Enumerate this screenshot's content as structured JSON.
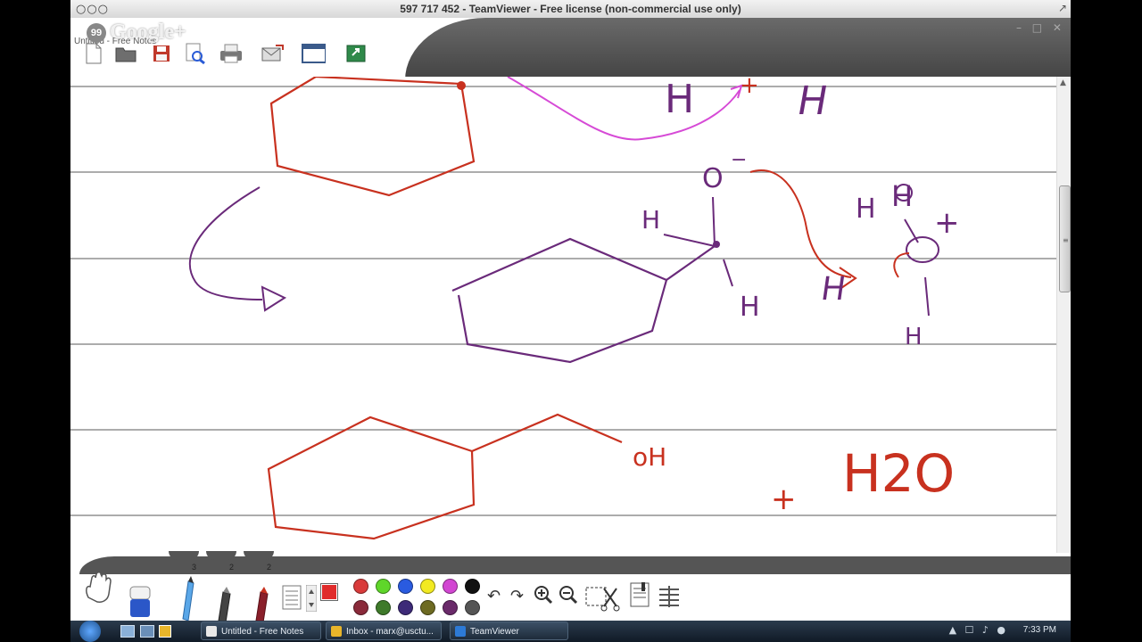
{
  "teamviewer": {
    "title": "597 717 452 - TeamViewer - Free license (non-commercial use only)",
    "window_controls": "○○○",
    "resize_icon": "resize-icon"
  },
  "app": {
    "tab_title": "Untitled - Free Notes",
    "overlay_badge": "99",
    "overlay_brand": "Google+",
    "toolbar": [
      {
        "name": "new-note-button",
        "icon": "new-document-icon"
      },
      {
        "name": "open-button",
        "icon": "folder-icon"
      },
      {
        "name": "save-button",
        "icon": "floppy-disk-icon"
      },
      {
        "name": "preview-button",
        "icon": "magnifier-page-icon"
      },
      {
        "name": "print-button",
        "icon": "printer-icon"
      },
      {
        "name": "email-button",
        "icon": "mail-icon"
      },
      {
        "name": "screen-button",
        "icon": "window-icon"
      },
      {
        "name": "export-button",
        "icon": "green-box-icon"
      }
    ]
  },
  "handwriting": {
    "labels_top": [
      "H",
      "+",
      "H"
    ],
    "labels_mid": [
      "O",
      "−",
      "H",
      "H",
      "H",
      "H",
      "+",
      "H",
      "H"
    ],
    "labels_bottom": [
      "oH",
      "+",
      "H2O"
    ]
  },
  "tools": {
    "pen_counts": [
      "3",
      "2",
      "2"
    ],
    "colors_row1": [
      "#d93b3b",
      "#5fd62a",
      "#2a5be0",
      "#f2ea21",
      "#d246d2",
      "#111111"
    ],
    "colors_row2": [
      "#8a2a3a",
      "#3e7a2a",
      "#3d2a78",
      "#6d6a22",
      "#6a2a6a",
      "#555555"
    ],
    "current_color": "#e02b2b"
  },
  "taskbar": {
    "items": [
      {
        "label": "Untitled - Free Notes",
        "icon_color": "#e8e8e8"
      },
      {
        "label": "Inbox - marx@usctu...",
        "icon_color": "#e8b52a"
      },
      {
        "label": "TeamViewer",
        "icon_color": "#2d7ad6"
      }
    ],
    "clock": "7:33 PM"
  }
}
